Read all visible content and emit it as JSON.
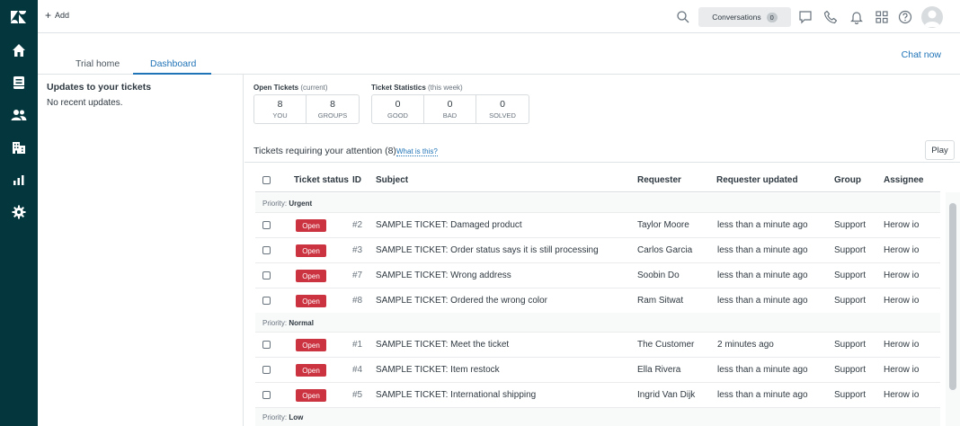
{
  "topbar": {
    "add_label": "Add",
    "conversations_label": "Conversations",
    "conversations_count": "0"
  },
  "tabs": [
    {
      "label": "Trial home"
    },
    {
      "label": "Dashboard"
    }
  ],
  "chat_now": "Chat now",
  "updates": {
    "title": "Updates to your tickets",
    "empty": "No recent updates."
  },
  "open_tickets": {
    "title": "Open Tickets",
    "qualifier": "(current)",
    "cells": [
      {
        "value": "8",
        "label": "YOU"
      },
      {
        "value": "8",
        "label": "GROUPS"
      }
    ]
  },
  "ticket_stats": {
    "title": "Ticket Statistics",
    "qualifier": "(this week)",
    "cells": [
      {
        "value": "0",
        "label": "GOOD"
      },
      {
        "value": "0",
        "label": "BAD"
      },
      {
        "value": "0",
        "label": "SOLVED"
      }
    ]
  },
  "tickets": {
    "title": "Tickets requiring your attention (8)",
    "what_link": "What is this?",
    "play_label": "Play",
    "columns": [
      "Ticket status",
      "ID",
      "Subject",
      "Requester",
      "Requester updated",
      "Group",
      "Assignee"
    ],
    "priority_prefix": "Priority:",
    "groups": [
      {
        "priority": "Urgent",
        "rows": [
          {
            "status": "Open",
            "id": "#2",
            "subject": "SAMPLE TICKET: Damaged product",
            "requester": "Taylor Moore",
            "updated": "less than a minute ago",
            "group": "Support",
            "assignee": "Herow io"
          },
          {
            "status": "Open",
            "id": "#3",
            "subject": "SAMPLE TICKET: Order status says it is still processing",
            "requester": "Carlos Garcia",
            "updated": "less than a minute ago",
            "group": "Support",
            "assignee": "Herow io"
          },
          {
            "status": "Open",
            "id": "#7",
            "subject": "SAMPLE TICKET: Wrong address",
            "requester": "Soobin Do",
            "updated": "less than a minute ago",
            "group": "Support",
            "assignee": "Herow io"
          },
          {
            "status": "Open",
            "id": "#8",
            "subject": "SAMPLE TICKET: Ordered the wrong color",
            "requester": "Ram Sitwat",
            "updated": "less than a minute ago",
            "group": "Support",
            "assignee": "Herow io"
          }
        ]
      },
      {
        "priority": "Normal",
        "rows": [
          {
            "status": "Open",
            "id": "#1",
            "subject": "SAMPLE TICKET: Meet the ticket",
            "requester": "The Customer",
            "updated": "2 minutes ago",
            "group": "Support",
            "assignee": "Herow io"
          },
          {
            "status": "Open",
            "id": "#4",
            "subject": "SAMPLE TICKET: Item restock",
            "requester": "Ella Rivera",
            "updated": "less than a minute ago",
            "group": "Support",
            "assignee": "Herow io"
          },
          {
            "status": "Open",
            "id": "#5",
            "subject": "SAMPLE TICKET: International shipping",
            "requester": "Ingrid Van Dijk",
            "updated": "less than a minute ago",
            "group": "Support",
            "assignee": "Herow io"
          }
        ]
      },
      {
        "priority": "Low",
        "rows": []
      }
    ]
  },
  "colors": {
    "nav_bg": "#03363d",
    "accent": "#1f73b7",
    "open_badge": "#cc3340"
  },
  "icons": [
    "zendesk-logo-icon",
    "home-icon",
    "views-icon",
    "customers-icon",
    "organizations-icon",
    "reporting-icon",
    "admin-gear-icon",
    "search-icon",
    "chat-icon",
    "phone-icon",
    "bell-icon",
    "apps-grid-icon",
    "help-icon",
    "avatar"
  ]
}
